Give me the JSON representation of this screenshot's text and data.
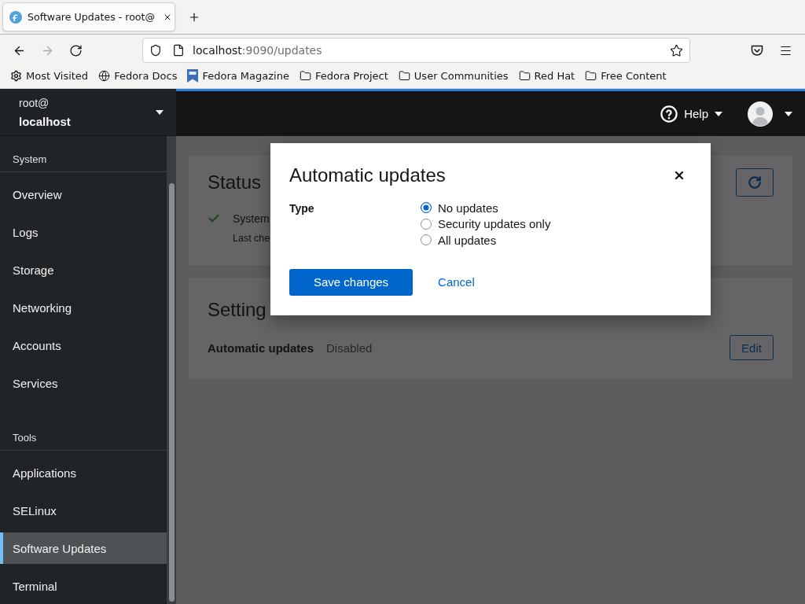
{
  "browser": {
    "tabs": [
      {
        "title": "Software Updates - root@",
        "selected": true
      }
    ],
    "nav_buttons": [
      {
        "kind": "back",
        "disabled": false
      },
      {
        "kind": "forward",
        "disabled": true
      },
      {
        "kind": "reload",
        "disabled": false
      }
    ],
    "address_bar": {
      "host": "localhost",
      "path": ":9090/updates"
    },
    "bookmarks": [
      {
        "kind": "link",
        "label": "Most Visited"
      },
      {
        "kind": "link",
        "label": "Fedora Docs"
      },
      {
        "kind": "link",
        "label": "Fedora Magazine"
      },
      {
        "kind": "folder",
        "label": "Fedora Project"
      },
      {
        "kind": "folder",
        "label": "User Communities"
      },
      {
        "kind": "folder",
        "label": "Red Hat"
      },
      {
        "kind": "folder",
        "label": "Free Content"
      }
    ]
  },
  "host_switcher": {
    "user": "root@",
    "host": "localhost"
  },
  "sidebar": [
    {
      "title": "System",
      "items": [
        {
          "label": "Overview",
          "selected": false
        },
        {
          "label": "Logs",
          "selected": false
        },
        {
          "label": "Storage",
          "selected": false
        },
        {
          "label": "Networking",
          "selected": false
        },
        {
          "label": "Accounts",
          "selected": false
        },
        {
          "label": "Services",
          "selected": false
        }
      ]
    },
    {
      "title": "Tools",
      "items": [
        {
          "label": "Applications",
          "selected": false
        },
        {
          "label": "SELinux",
          "selected": false
        },
        {
          "label": "Software Updates",
          "selected": true
        },
        {
          "label": "Terminal",
          "selected": false
        }
      ]
    }
  ],
  "masthead": {
    "help": "Help"
  },
  "status_card": {
    "title": "Status",
    "message": "System",
    "detail": "Last che"
  },
  "settings_card": {
    "title": "Setting",
    "rows": [
      {
        "label": "Automatic updates",
        "value": "Disabled",
        "action": "Edit"
      }
    ]
  },
  "dialog": {
    "title": "Automatic updates",
    "field_label": "Type",
    "options": [
      {
        "label": "No updates",
        "selected": true
      },
      {
        "label": "Security updates only",
        "selected": false
      },
      {
        "label": "All updates",
        "selected": false
      }
    ],
    "buttons": [
      {
        "label": "Save changes",
        "kind": "primary"
      },
      {
        "label": "Cancel",
        "kind": "link"
      }
    ]
  }
}
